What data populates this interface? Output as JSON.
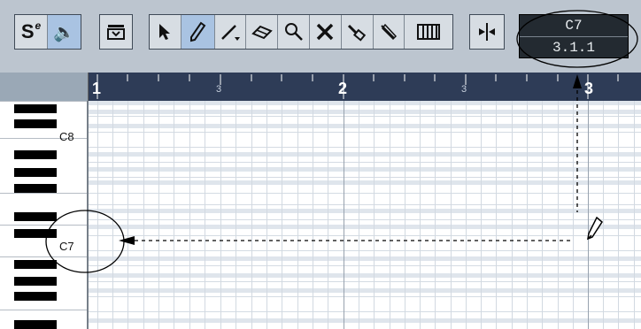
{
  "toolbar": {
    "solo_label": "S",
    "tools": [
      "object-selection",
      "draw",
      "line",
      "erase",
      "zoom",
      "mute",
      "glue",
      "split",
      "split-grid"
    ],
    "selected_tool": "draw"
  },
  "display": {
    "pitch": "C7",
    "position": "3.1.1"
  },
  "ruler": {
    "labels": [
      "1",
      "3",
      "2",
      "3",
      "3"
    ]
  },
  "keyboard": {
    "labels": [
      "C8",
      "C7"
    ]
  },
  "colors": {
    "toolbar_bg": "#bcc5cf",
    "ruler_bg": "#2e3c57",
    "active_tool": "#a9c3e2"
  }
}
